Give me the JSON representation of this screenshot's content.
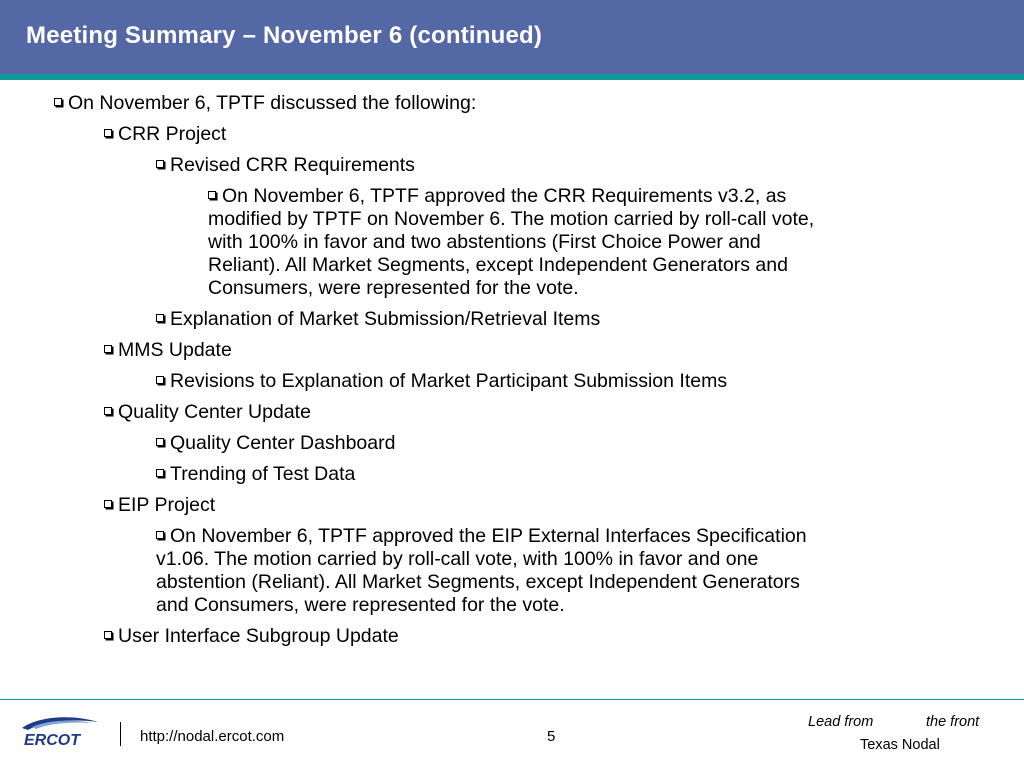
{
  "slide": {
    "title": "Meeting Summary – November 6 (continued)",
    "page_number": "5"
  },
  "bullets": [
    {
      "level": 1,
      "lines": [
        "On November 6, TPTF discussed the following:"
      ]
    },
    {
      "level": 2,
      "lines": [
        "CRR Project"
      ]
    },
    {
      "level": 3,
      "lines": [
        "Revised CRR Requirements"
      ]
    },
    {
      "level": 4,
      "lines": [
        "On November 6, TPTF approved the CRR Requirements v3.2, as",
        "modified by TPTF on November 6.  The motion carried by roll-call vote,",
        "with 100% in favor and two abstentions (First Choice Power and",
        "Reliant). All Market Segments, except Independent Generators and",
        "Consumers, were represented for the vote."
      ]
    },
    {
      "level": 3,
      "lines": [
        "Explanation of Market Submission/Retrieval Items"
      ]
    },
    {
      "level": 2,
      "lines": [
        "MMS Update"
      ]
    },
    {
      "level": 3,
      "lines": [
        "Revisions to Explanation of Market Participant Submission Items"
      ]
    },
    {
      "level": 2,
      "lines": [
        "Quality Center Update"
      ]
    },
    {
      "level": 3,
      "lines": [
        "Quality Center Dashboard"
      ]
    },
    {
      "level": 3,
      "lines": [
        "Trending of Test Data"
      ]
    },
    {
      "level": 2,
      "lines": [
        "EIP Project"
      ]
    },
    {
      "level": 3,
      "lines": [
        "On November 6, TPTF approved the EIP External Interfaces Specification",
        "v1.06.  The motion carried by roll-call vote, with 100% in favor and one",
        "abstention (Reliant).  All Market Segments, except Independent Generators",
        "and Consumers, were represented for the vote."
      ]
    },
    {
      "level": 2,
      "lines": [
        "User Interface Subgroup Update"
      ]
    }
  ],
  "footer": {
    "url": "http://nodal.ercot.com",
    "logo_text": "ERCOT",
    "tagline_lead": "Lead from",
    "tagline_front": "the front",
    "tagline_org": "Texas Nodal"
  },
  "colors": {
    "title_bar": "#5468a6",
    "accent_stripe": "#0f9a9a",
    "logo_blue": "#1f3a8a"
  }
}
